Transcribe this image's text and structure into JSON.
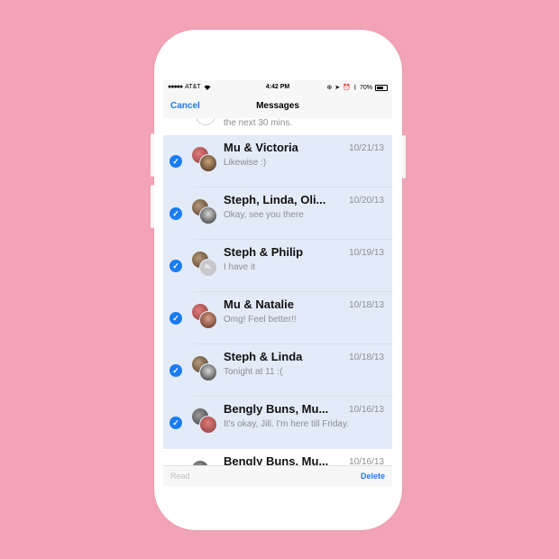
{
  "status": {
    "carrier": "AT&T",
    "time": "4:42 PM",
    "battery": "70%"
  },
  "nav": {
    "cancel": "Cancel",
    "title": "Messages"
  },
  "partial_row": {
    "preview": "the next 30 mins."
  },
  "conversations": [
    {
      "name": "Mu & Victoria",
      "date": "10/21/13",
      "preview": "Likewise :)",
      "selected": true
    },
    {
      "name": "Steph, Linda, Oli...",
      "date": "10/20/13",
      "preview": "Okay, see you there",
      "selected": true
    },
    {
      "name": "Steph & Philip",
      "date": "10/19/13",
      "preview": "I have it",
      "selected": true,
      "avatar_initials": "PL"
    },
    {
      "name": "Mu & Natalie",
      "date": "10/18/13",
      "preview": "Omg! Feel better!!",
      "selected": true
    },
    {
      "name": "Steph & Linda",
      "date": "10/18/13",
      "preview": "Tonight at 11 :(",
      "selected": true
    },
    {
      "name": "Bengly Buns, Mu...",
      "date": "10/16/13",
      "preview": "It's okay, Jill. I'm here till Friday.",
      "selected": true
    },
    {
      "name": "Bengly Buns, Mu...",
      "date": "10/16/13",
      "preview": "",
      "selected": false
    }
  ],
  "toolbar": {
    "read": "Read",
    "delete": "Delete"
  },
  "colors": {
    "background": "#f2a3b5",
    "accent": "#1a7cf0",
    "selected_row": "#e3ebf8"
  }
}
